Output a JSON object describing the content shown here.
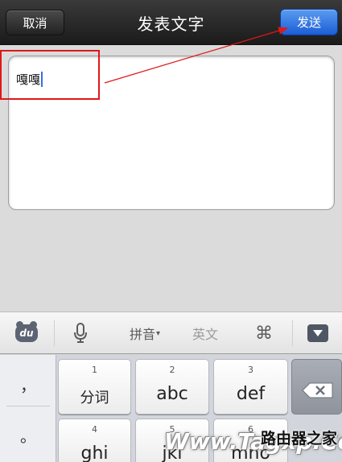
{
  "header": {
    "title": "发表文字",
    "cancel_label": "取消",
    "send_label": "发送"
  },
  "compose": {
    "text": "嘎嘎"
  },
  "ime_toolbar": {
    "logo_text": "du",
    "pinyin_label": "拼音",
    "pinyin_caret": "▾",
    "english_label": "英文",
    "icons": [
      "baidu-du-logo-icon",
      "microphone-icon",
      "command-icon",
      "collapse-keyboard-icon"
    ]
  },
  "keyboard": {
    "punctuation": [
      "，",
      "。"
    ],
    "keys": [
      {
        "num": "1",
        "label": "分词"
      },
      {
        "num": "2",
        "label": "abc"
      },
      {
        "num": "3",
        "label": "def"
      },
      {
        "num": "4",
        "label": "ghi"
      },
      {
        "num": "5",
        "label": "jkl"
      },
      {
        "num": "6",
        "label": "mno"
      }
    ]
  },
  "watermark": {
    "text": "Www.Tagxp.Com",
    "cn_text": "路由器之家"
  },
  "colors": {
    "send_button": "#2a6fe0",
    "annotation_red": "#e01818",
    "navbar": "#2a2a2a"
  }
}
